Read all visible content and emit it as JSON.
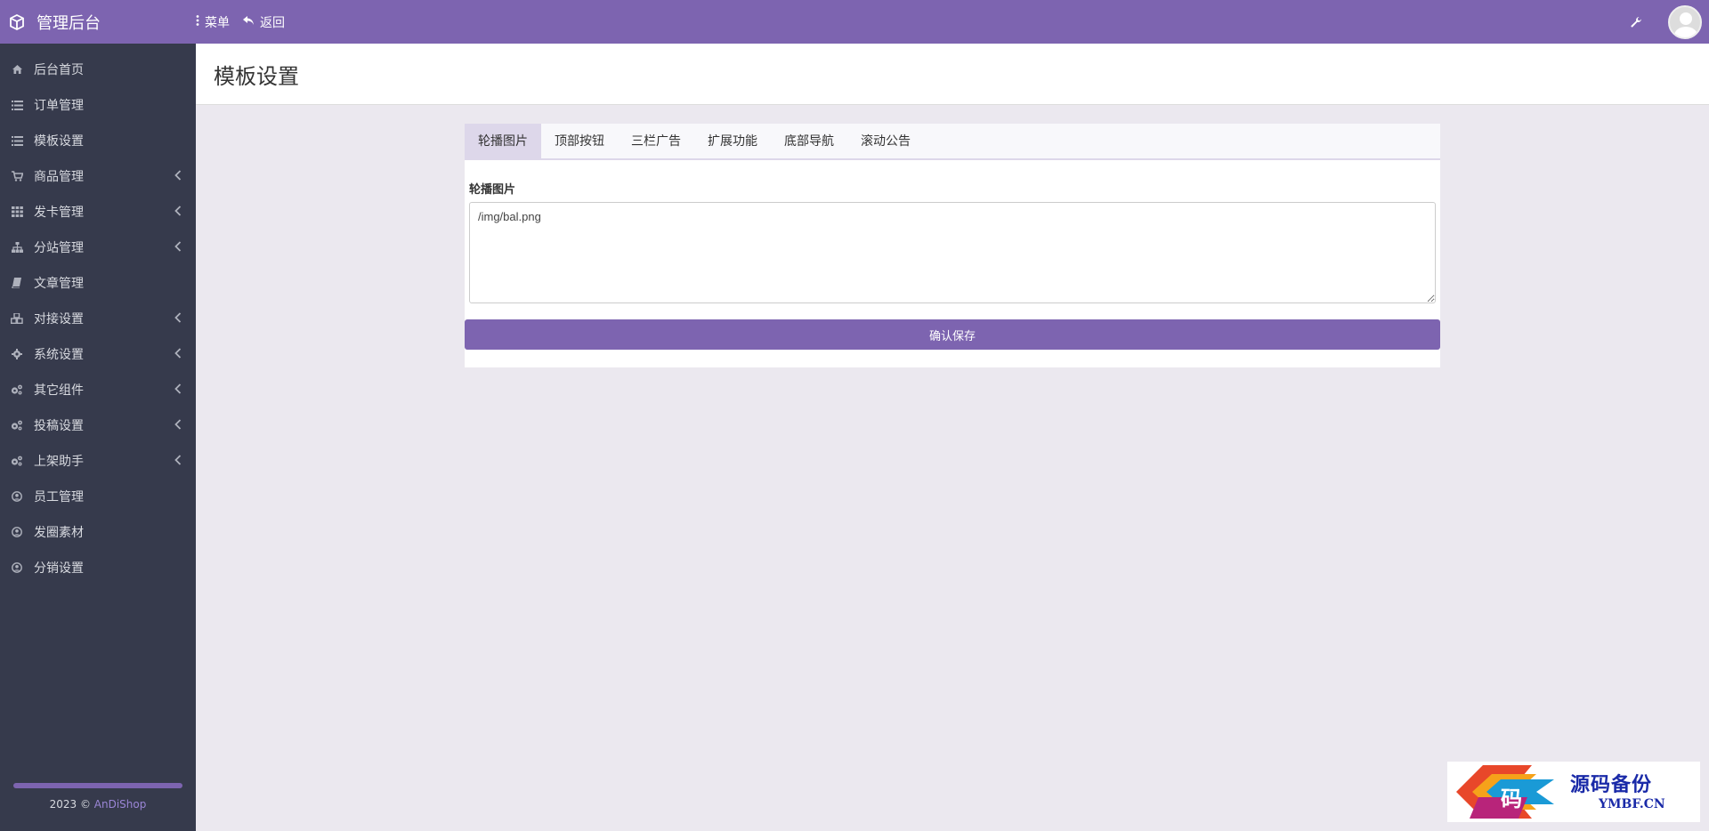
{
  "app": {
    "title": "管理后台"
  },
  "topnav": {
    "menu_label": "菜单",
    "back_label": "返回"
  },
  "sidebar": {
    "items": [
      {
        "label": "后台首页",
        "icon": "home-icon",
        "has_children": false
      },
      {
        "label": "订单管理",
        "icon": "list-icon",
        "has_children": false
      },
      {
        "label": "模板设置",
        "icon": "list-icon",
        "has_children": false
      },
      {
        "label": "商品管理",
        "icon": "cart-icon",
        "has_children": true
      },
      {
        "label": "发卡管理",
        "icon": "grid-icon",
        "has_children": true
      },
      {
        "label": "分站管理",
        "icon": "sitemap-icon",
        "has_children": true
      },
      {
        "label": "文章管理",
        "icon": "book-icon",
        "has_children": false
      },
      {
        "label": "对接设置",
        "icon": "cubes-icon",
        "has_children": true
      },
      {
        "label": "系统设置",
        "icon": "gear-icon",
        "has_children": true
      },
      {
        "label": "其它组件",
        "icon": "gears-icon",
        "has_children": true
      },
      {
        "label": "投稿设置",
        "icon": "gears-icon",
        "has_children": true
      },
      {
        "label": "上架助手",
        "icon": "gears-icon",
        "has_children": true
      },
      {
        "label": "员工管理",
        "icon": "user-circle-icon",
        "has_children": false
      },
      {
        "label": "发圈素材",
        "icon": "user-circle-icon",
        "has_children": false
      },
      {
        "label": "分销设置",
        "icon": "user-circle-icon",
        "has_children": false
      }
    ],
    "copyright_prefix": "2023 © ",
    "copyright_link": "AnDiShop"
  },
  "page": {
    "title": "模板设置"
  },
  "tabs": [
    "轮播图片",
    "顶部按钮",
    "三栏广告",
    "扩展功能",
    "底部导航",
    "滚动公告"
  ],
  "form": {
    "field_label": "轮播图片",
    "textarea_value": "/img/bal.png",
    "save_label": "确认保存"
  },
  "watermark": {
    "text": "源码备份",
    "sub": "YMBF.CN",
    "glyph": "码"
  },
  "colors": {
    "accent": "#7d64b0",
    "sidebar_bg": "#363a4c",
    "page_bg": "#ebe8ef"
  }
}
